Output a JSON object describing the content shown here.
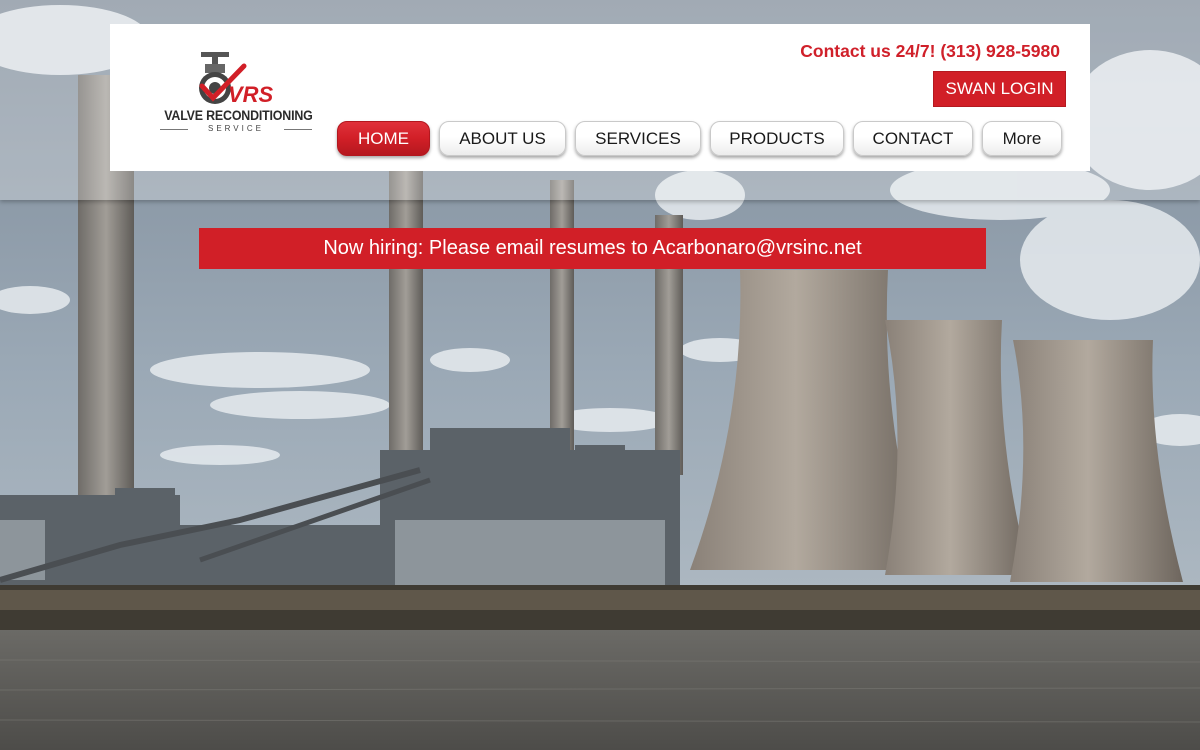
{
  "logo": {
    "name": "VALVE RECONDITIONING",
    "sub": "SERVICE",
    "mark": "VRS"
  },
  "header": {
    "contact": "Contact us 24/7! (313) 928-5980",
    "login_label": "SWAN LOGIN"
  },
  "nav": {
    "items": [
      {
        "label": "HOME",
        "active": true
      },
      {
        "label": "ABOUT US"
      },
      {
        "label": "SERVICES"
      },
      {
        "label": "PRODUCTS"
      },
      {
        "label": "CONTACT"
      },
      {
        "label": "More"
      }
    ]
  },
  "banner": {
    "text": "Now hiring: Please email resumes to Acarbonaro@vrsinc.net"
  },
  "colors": {
    "brand_red": "#d11f27",
    "contact_red": "#d0202a"
  }
}
